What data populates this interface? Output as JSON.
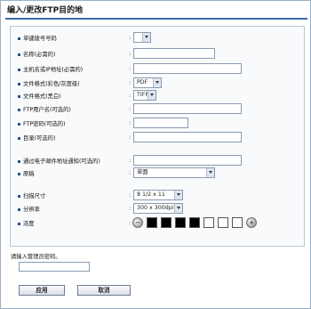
{
  "title": "编入/更改FTP目的地",
  "form": {
    "speed_dial": {
      "label": "单键拨号号码",
      "value": ""
    },
    "name": {
      "label": "名称(必需的)",
      "value": ""
    },
    "host": {
      "label": "主机名或IP地址(必需的)",
      "value": ""
    },
    "file_format_color": {
      "label": "文件格式(彩色/灰度级)",
      "value": "PDF"
    },
    "file_format_bw": {
      "label": "文件格式(黑白)",
      "value": "TIFF"
    },
    "ftp_user": {
      "label": "FTP用户名(可选的)",
      "value": ""
    },
    "ftp_password": {
      "label": "FTP密码(可选的)",
      "value": ""
    },
    "directory": {
      "label": "目录(可选的)",
      "value": ""
    },
    "notify_email": {
      "label": "通过电子邮件地址通知(可选的)",
      "value": ""
    },
    "original": {
      "label": "原稿",
      "value": "单面"
    },
    "scan_size": {
      "label": "扫描尺寸",
      "value": "8 1/2 x 11"
    },
    "resolution": {
      "label": "分辨率",
      "value": "300 x 300dpi"
    },
    "density": {
      "label": "浓度",
      "minus_icon": "lighter-icon",
      "plus_icon": "darker-icon",
      "level": 4,
      "steps": 7
    }
  },
  "admin": {
    "label": "请输入管理员密码。",
    "value": ""
  },
  "buttons": {
    "apply": "应用",
    "cancel": "取消"
  },
  "colors": {
    "accent": "#3a6aa8",
    "border": "#8a9bb0",
    "bullet": "#2c4f8a"
  }
}
